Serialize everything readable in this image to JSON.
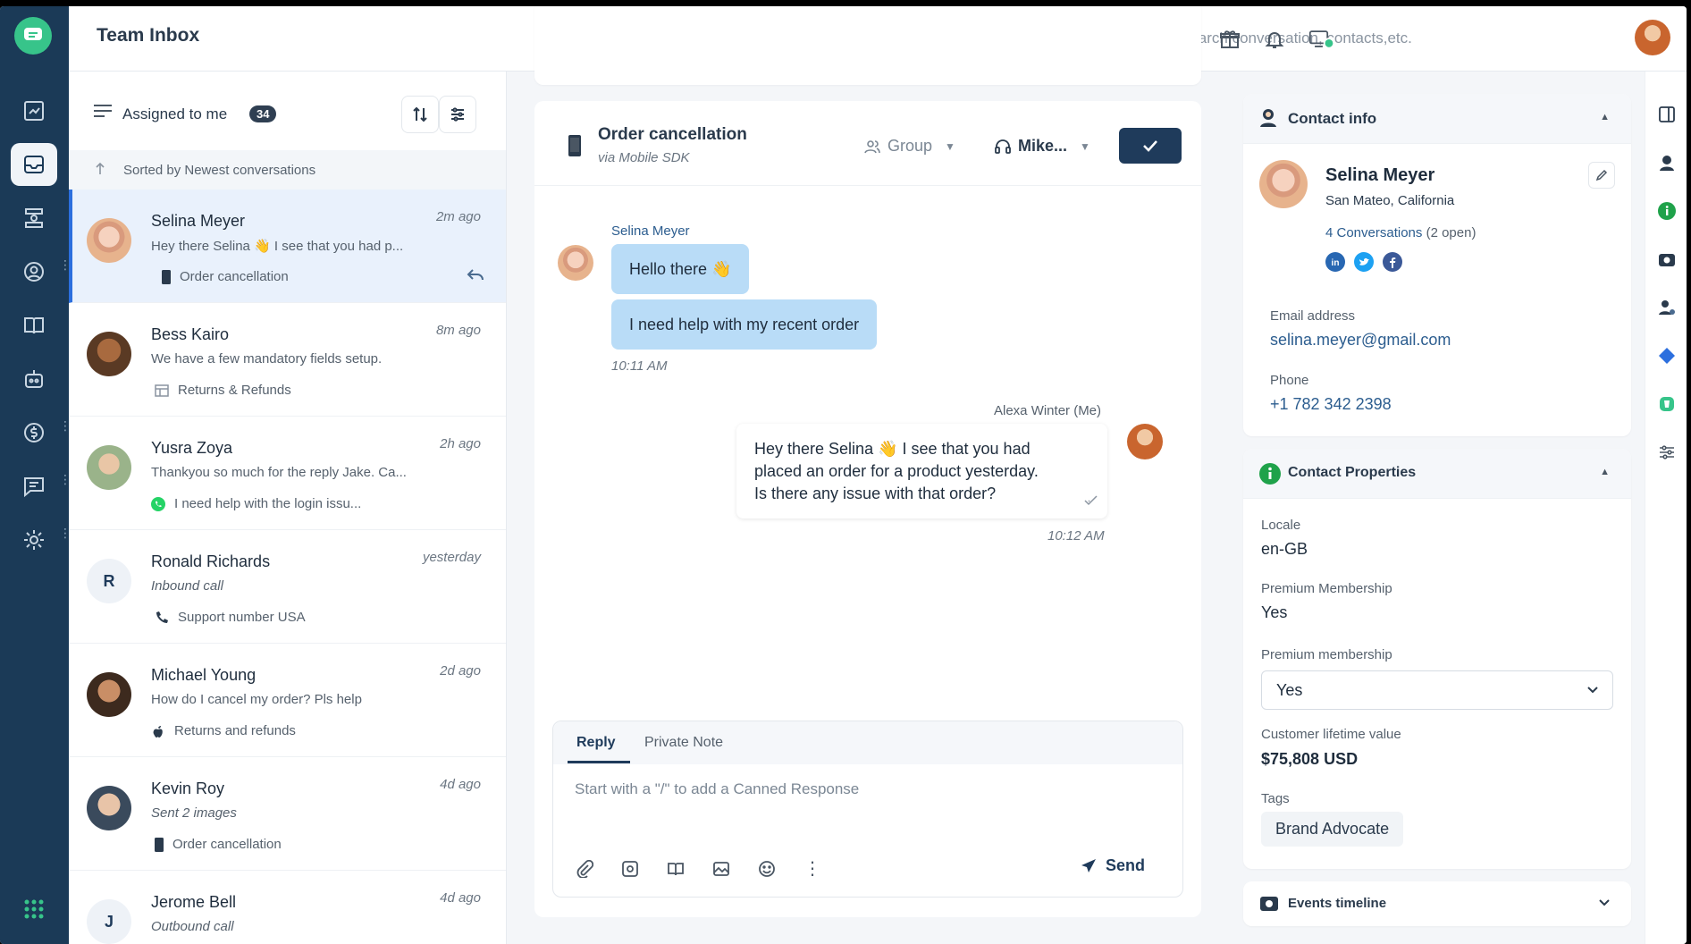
{
  "app": {
    "title": "Team Inbox",
    "search_placeholder": "Search conversation, contacts,etc."
  },
  "conversation_list": {
    "filter_label": "Assigned to me",
    "count": "34",
    "sort_text": "Sorted by Newest conversations",
    "items": [
      {
        "name": "Selina Meyer",
        "time": "2m ago",
        "preview": "Hey there Selina 👋 I see that you had p...",
        "meta": "Order cancellation",
        "meta_icon": "mobile-icon",
        "preview_italic": false
      },
      {
        "name": "Bess Kairo",
        "time": "8m ago",
        "preview": "We have a few mandatory fields setup.",
        "meta": "Returns & Refunds",
        "meta_icon": "web-icon",
        "preview_italic": false
      },
      {
        "name": "Yusra Zoya",
        "time": "2h ago",
        "preview": "Thankyou so much for the reply Jake. Ca...",
        "meta": "I need help with the login issu...",
        "meta_icon": "whatsapp-icon",
        "preview_italic": false
      },
      {
        "name": "Ronald Richards",
        "time": "yesterday",
        "preview": "Inbound call",
        "meta": "Support number USA",
        "meta_icon": "phone-icon",
        "preview_italic": true,
        "initial": "R"
      },
      {
        "name": "Michael Young",
        "time": "2d ago",
        "preview": "How do I cancel my order? Pls help",
        "meta": "Returns and refunds",
        "meta_icon": "apple-icon",
        "preview_italic": false
      },
      {
        "name": "Kevin Roy",
        "time": "4d ago",
        "preview": "Sent 2 images",
        "meta": "Order cancellation",
        "meta_icon": "mobile-icon",
        "preview_italic": true
      },
      {
        "name": "Jerome Bell",
        "time": "4d ago",
        "preview": "Outbound call",
        "meta": "",
        "meta_icon": "phone-icon",
        "preview_italic": true,
        "initial": "J"
      }
    ]
  },
  "chat": {
    "subject": "Order cancellation",
    "via": "via Mobile SDK",
    "group_label": "Group",
    "agent_label": "Mike...",
    "incoming_sender": "Selina Meyer",
    "incoming_messages": [
      "Hello there 👋",
      "I need help with my recent order"
    ],
    "incoming_time": "10:11 AM",
    "outgoing_sender": "Alexa Winter (Me)",
    "outgoing_lines": [
      "Hey there Selina 👋 I see that you had",
      "placed an order for a product yesterday.",
      "Is there any issue with that order?"
    ],
    "outgoing_time": "10:12 AM",
    "composer": {
      "tab_reply": "Reply",
      "tab_note": "Private Note",
      "placeholder": "Start with a \"/\" to add a Canned Response",
      "send_label": "Send"
    }
  },
  "contact_info": {
    "title": "Contact info",
    "name": "Selina Meyer",
    "location": "San Mateo, California",
    "conversations_link": "4 Conversations",
    "conversations_open": "(2 open)",
    "email_label": "Email address",
    "email": "selina.meyer@gmail.com",
    "phone_label": "Phone",
    "phone": "+1 782 342 2398",
    "social": [
      "linkedin-icon",
      "twitter-icon",
      "facebook-icon"
    ]
  },
  "contact_properties": {
    "title": "Contact Properties",
    "locale_label": "Locale",
    "locale": "en-GB",
    "premium_label": "Premium Membership",
    "premium": "Yes",
    "premium_select_label": "Premium membership",
    "premium_select_value": "Yes",
    "ltv_label": "Customer lifetime value",
    "ltv": "$75,808 USD",
    "tags_label": "Tags",
    "tag": "Brand Advocate"
  },
  "events": {
    "title": "Events timeline"
  },
  "colors": {
    "rail": "#1b3a57",
    "accent": "#1f3b5b",
    "bubble_in": "#b9dcf7",
    "active_row": "#e9f1fc",
    "green": "#37c48a"
  }
}
